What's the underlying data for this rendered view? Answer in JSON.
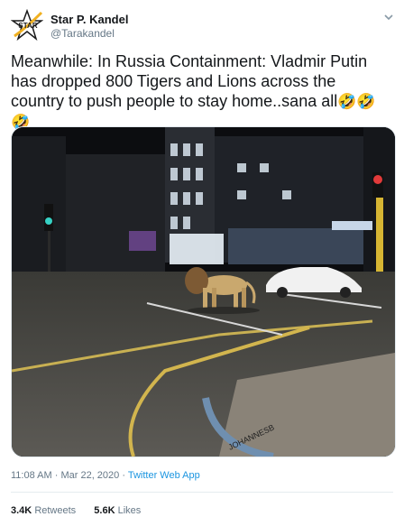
{
  "user": {
    "name": "Star P. Kandel",
    "handle": "@Tarakandel",
    "avatar_text": "STAR"
  },
  "tweet": {
    "text": "Meanwhile: In Russia Containment: Vladmir Putin has dropped 800 Tigers and Lions across the country to push people to stay home..sana all",
    "emojis": [
      "🤣",
      "🤣",
      "🤣"
    ]
  },
  "media": {
    "description": "photo",
    "curb_text": "JOHANNESB"
  },
  "meta": {
    "time": "11:08 AM",
    "sep1": " · ",
    "date": "Mar 22, 2020",
    "sep2": " · ",
    "source": "Twitter Web App"
  },
  "stats": {
    "retweets_count": "3.4K",
    "retweets_label": "Retweets",
    "likes_count": "5.6K",
    "likes_label": "Likes"
  },
  "colors": {
    "link": "#1b95e0",
    "muted": "#657786",
    "text": "#14171a"
  },
  "icons": [
    "star-logo-icon",
    "chevron-down-icon"
  ]
}
